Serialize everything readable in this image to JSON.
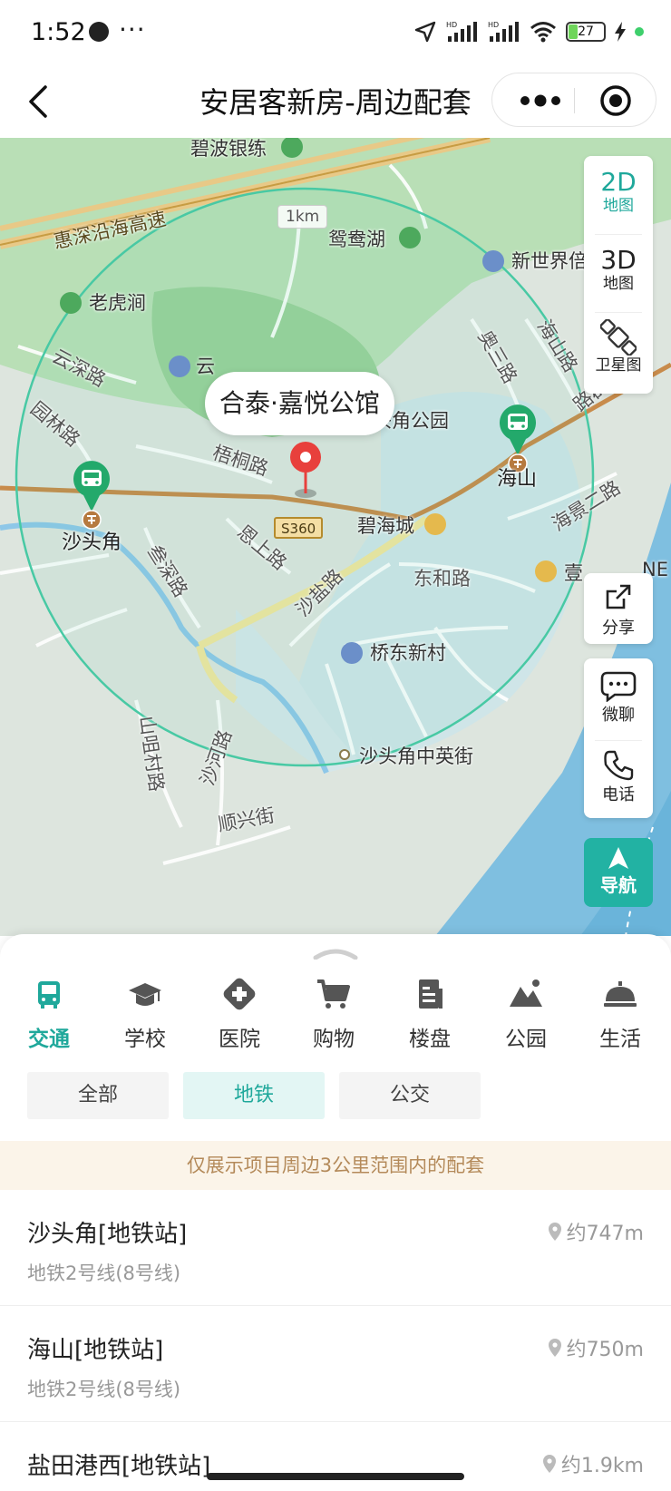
{
  "status_bar": {
    "time": "1:52",
    "more": "···",
    "battery": "27",
    "battery_level": 0.27
  },
  "header": {
    "title": "安居客新房-周边配套"
  },
  "map": {
    "scale": "1km",
    "project_name": "合泰·嘉悦公馆",
    "road_badge": "S360",
    "labels": {
      "bibo": "碧波银练",
      "expressway": "惠深沿海高速",
      "yuanyang_lake": "鸳鸯湖",
      "new_world": "新世界倍",
      "laohu": "老虎涧",
      "yunshen": "云深路",
      "yun": "云",
      "yuanlin": "园林路",
      "shatoujiao_park": "沙头角公园",
      "wutong": "梧桐路",
      "aosan": "奥三路",
      "haishan_road": "海山路",
      "binhe": "路群",
      "haijing": "海景二路",
      "bihaicheng": "碧海城",
      "sanshen": "叁深路",
      "enshang": "恩上路",
      "shayan": "沙盐路",
      "donghe": "东和路",
      "yi": "壹",
      "ne": "NE",
      "qiaodong": "桥东新村",
      "shanzu": "山咀村路",
      "shahe": "沙河路",
      "zhongying": "沙头角中英街",
      "shunxing": "顺兴街"
    },
    "stations": [
      {
        "name": "沙头角"
      },
      {
        "name": "海山"
      }
    ],
    "tools": {
      "map2d": "2D",
      "map2d_sub": "地图",
      "map3d": "3D",
      "map3d_sub": "地图",
      "satellite": "卫星图"
    },
    "share": "分享",
    "chat": "微聊",
    "phone": "电话",
    "navigate": "导航"
  },
  "categories": [
    {
      "label": "交通",
      "icon": "bus-icon",
      "active": true
    },
    {
      "label": "学校",
      "icon": "school-icon",
      "active": false
    },
    {
      "label": "医院",
      "icon": "hospital-icon",
      "active": false
    },
    {
      "label": "购物",
      "icon": "cart-icon",
      "active": false
    },
    {
      "label": "楼盘",
      "icon": "building-icon",
      "active": false
    },
    {
      "label": "公园",
      "icon": "park-icon",
      "active": false
    },
    {
      "label": "生活",
      "icon": "service-bell-icon",
      "active": false
    }
  ],
  "chips": [
    {
      "label": "全部",
      "active": false
    },
    {
      "label": "地铁",
      "active": true
    },
    {
      "label": "公交",
      "active": false
    }
  ],
  "notice": "仅展示项目周边3公里范围内的配套",
  "list": [
    {
      "title": "沙头角[地铁站]",
      "sub": "地铁2号线(8号线)",
      "distance": "约747m"
    },
    {
      "title": "海山[地铁站]",
      "sub": "地铁2号线(8号线)",
      "distance": "约750m"
    },
    {
      "title": "盐田港西[地铁站]",
      "sub": "",
      "distance": "约1.9km"
    }
  ],
  "colors": {
    "accent": "#22b2a3",
    "pin": "#e8403c",
    "notice_text": "#b48a5a"
  }
}
